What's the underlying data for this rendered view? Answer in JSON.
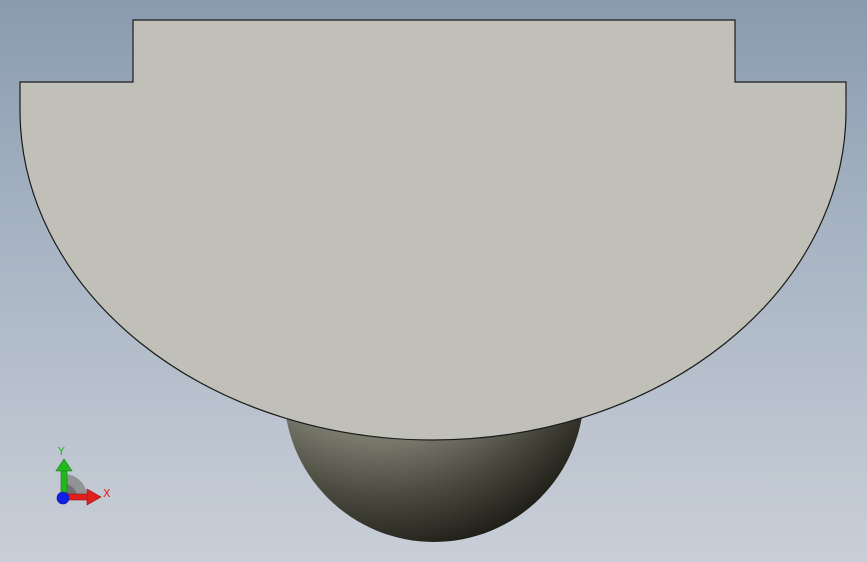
{
  "viewport": {
    "background_top": "#8a9bb0",
    "background_bottom": "#c9cfd8",
    "part_face_color": "#c0c0b8",
    "part_edge_color": "#1a1a1a",
    "sphere_highlight": "#e9e9dc",
    "sphere_shadow": "#101008"
  },
  "triad": {
    "x_label": "X",
    "y_label": "Y",
    "x_color": "#e0201c",
    "y_color": "#22b81e",
    "z_color": "#1020e8"
  }
}
